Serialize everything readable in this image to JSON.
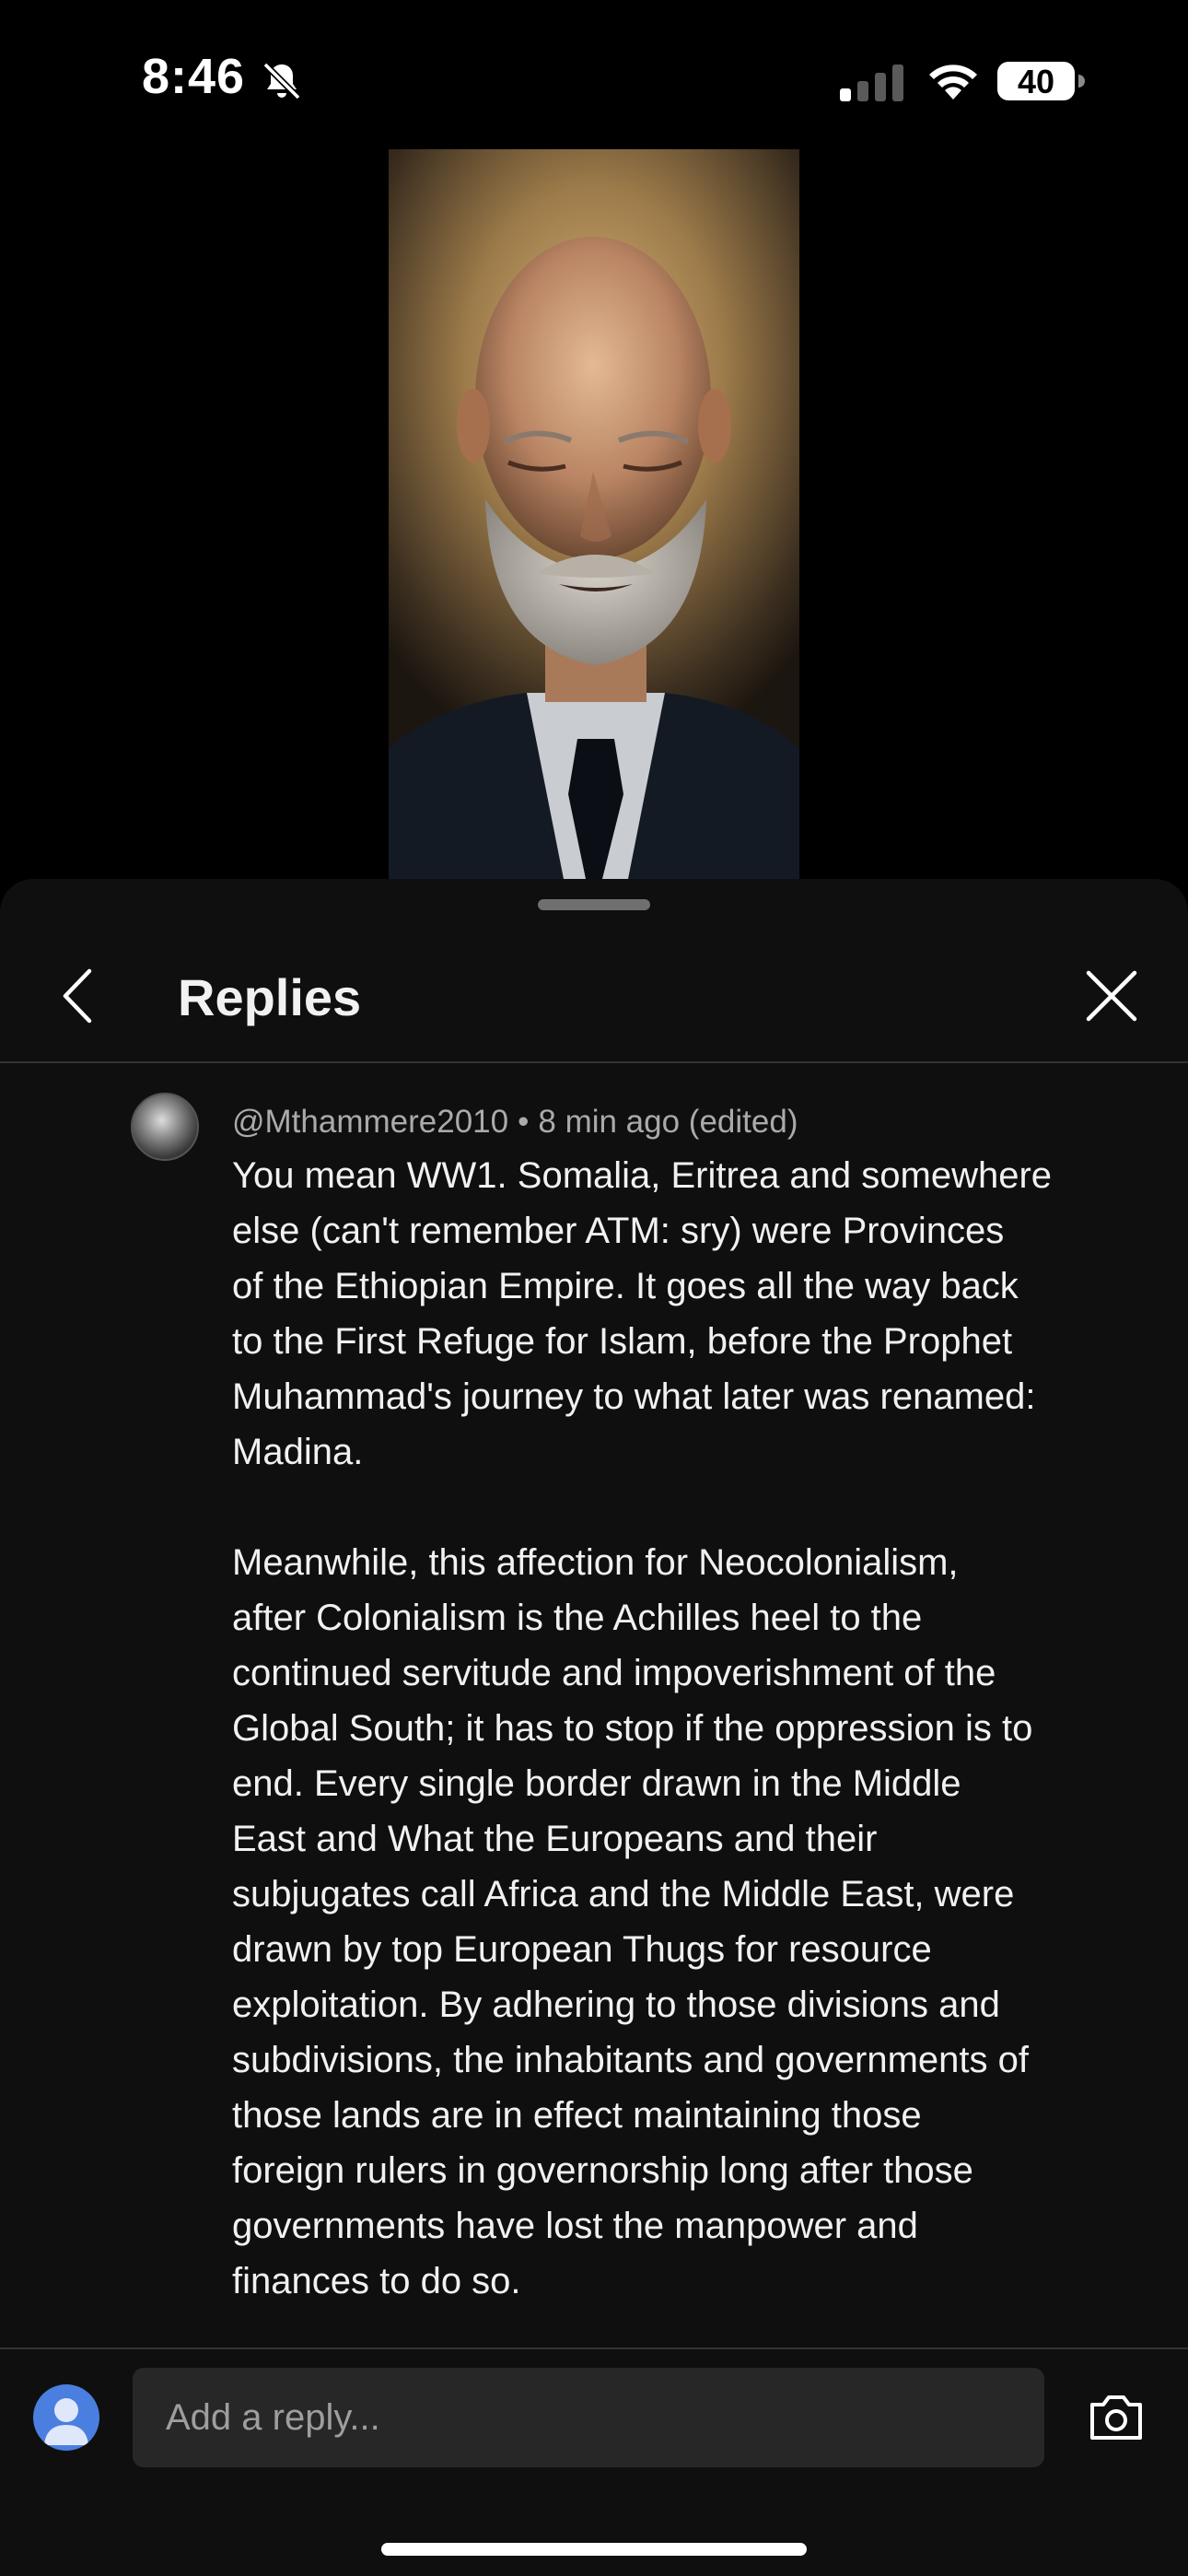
{
  "status_bar": {
    "time": "8:46",
    "battery_level": "40",
    "icons": [
      "bell-slash-icon",
      "cellular-signal-icon",
      "wifi-icon",
      "battery-icon"
    ]
  },
  "video": {
    "description_icon": "video-frame"
  },
  "sheet": {
    "title": "Replies",
    "back_icon": "chevron-left-icon",
    "close_icon": "close-icon"
  },
  "comment": {
    "author": "@Mthammere2010",
    "separator": "•",
    "time": "8 min ago (edited)",
    "paragraph_1": [
      "You mean WW1. Somalia, Eritrea and somewhere",
      "else (can't remember ATM: sry) were Provinces",
      "of the Ethiopian Empire. It goes all the way back",
      "to the First Refuge for Islam, before the Prophet",
      "Muhammad's journey to what later was renamed:",
      "Madina."
    ],
    "paragraph_2": [
      "Meanwhile, this affection for Neocolonialism,",
      "after Colonialism is the Achilles heel to the",
      "continued servitude and impoverishment of the",
      "Global South; it has to stop if the oppression is to",
      "end. Every single border drawn in the Middle",
      "East and What the Europeans and their",
      "subjugates call Africa and the Middle East, were",
      "drawn by top European Thugs for resource",
      "exploitation. By adhering to those divisions and",
      "subdivisions, the inhabitants and governments of",
      "those lands are in effect maintaining those",
      "foreign rulers in governorship long after those",
      "governments have lost the manpower and",
      "finances to do so."
    ]
  },
  "reply_bar": {
    "placeholder": "Add a reply...",
    "camera_icon": "camera-icon",
    "avatar_icon": "user-avatar-icon"
  },
  "colors": {
    "background": "#000000",
    "sheet": "#0f0f0f",
    "input": "#272727",
    "secondary_text": "#aaaaaa",
    "avatar_blue": "#4a7fe0"
  }
}
